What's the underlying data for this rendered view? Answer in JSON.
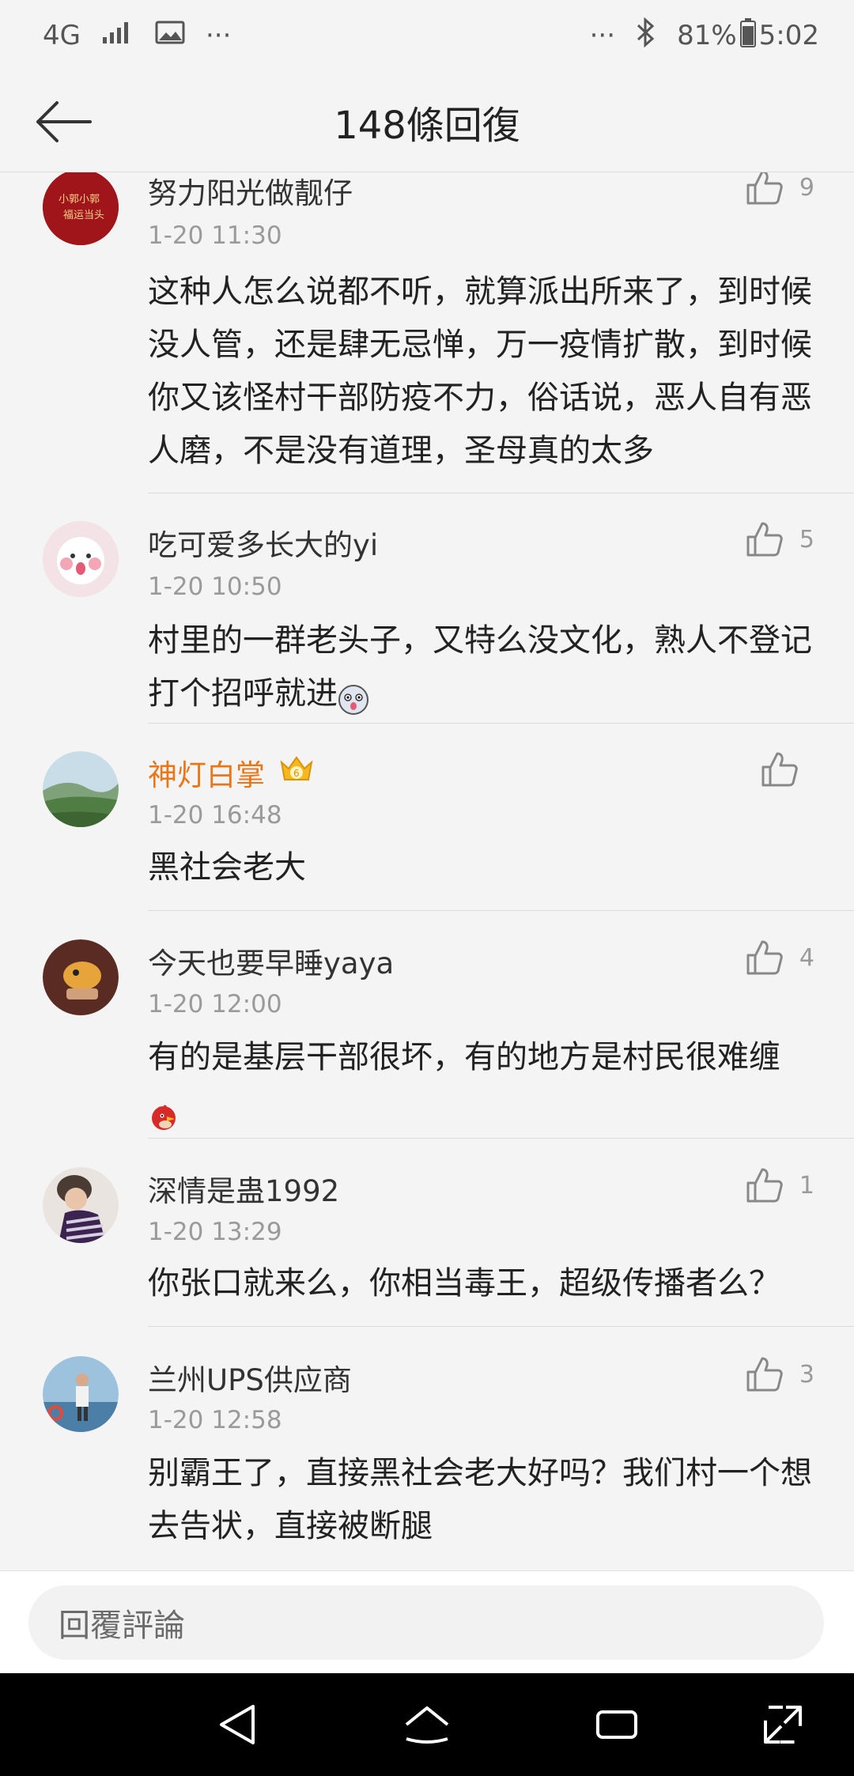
{
  "status_bar": {
    "network": "4G",
    "more_left": "···",
    "more_right": "···",
    "battery": "81%",
    "time": "5:02"
  },
  "header": {
    "title": "148條回復",
    "back_icon": "arrow-left-icon"
  },
  "comments": [
    {
      "name": "努力阳光做靓仔",
      "time": "1-20 11:30",
      "likes": "9",
      "text": "这种人怎么说都不听，就算派出所来了，到时候没人管，还是肆无忌惮，万一疫情扩散，到时候你又该怪村干部防疫不力，俗话说，恶人自有恶人磨，不是没有道理，圣母真的太多"
    },
    {
      "name": "吃可爱多长大的yi",
      "time": "1-20 10:50",
      "likes": "5",
      "text": "村里的一群老头子，又特么没文化，熟人不登记打个招呼就进"
    },
    {
      "name": "神灯白掌",
      "time": "1-20 16:48",
      "likes": "",
      "text": "黑社会老大",
      "badge": "6"
    },
    {
      "name": "今天也要早睡yaya",
      "time": "1-20 12:00",
      "likes": "4",
      "text": "有的是基层干部很坏，有的地方是村民很难缠"
    },
    {
      "name": "深情是蛊1992",
      "time": "1-20 13:29",
      "likes": "1",
      "text": "你张口就来么，你相当毒王，超级传播者么？"
    },
    {
      "name": "兰州UPS供应商",
      "time": "1-20 12:58",
      "likes": "3",
      "text": "别霸王了，直接黑社会老大好吗？我们村一个想去告状，直接被断腿"
    }
  ],
  "reply_bar": {
    "placeholder": "回覆評論"
  },
  "colors": {
    "background": "#f4f4f4",
    "vip_name": "#e8761a",
    "muted": "#9a9a9a"
  }
}
